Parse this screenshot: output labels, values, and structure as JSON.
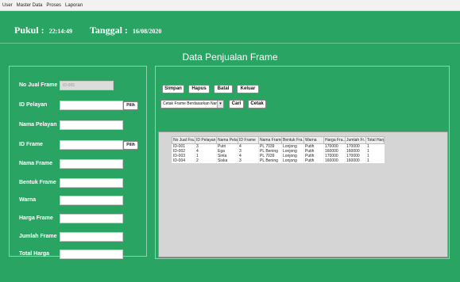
{
  "menu": [
    "User",
    "Master Data",
    "Proses",
    "Laporan"
  ],
  "header": {
    "pukul_label": "Pukul :",
    "pukul_value": "22:14:49",
    "tanggal_label": "Tanggal :",
    "tanggal_value": "16/08/2020"
  },
  "title": "Data Penjualan Frame",
  "form": {
    "no_jual_label": "No Jual Frame",
    "no_jual_value": "ID-005",
    "id_pelayan_label": "ID Pelayan",
    "nama_pelayan_label": "Nama Pelayan",
    "id_frame_label": "ID Frame",
    "nama_frame_label": "Nama Frame",
    "bentuk_frame_label": "Bentuk Frame",
    "warna_label": "Warna",
    "harga_frame_label": "Harga Frame",
    "jumlah_frame_label": "Jumlah Frame",
    "total_harga_label": "Total Harga",
    "pilih_label": "Pilih"
  },
  "actions": {
    "simpan": "Simpan",
    "hapus": "Hapus",
    "batal": "Batal",
    "keluar": "Keluar",
    "cetak_combo": "Cetak Frame Berdasarkan Nam",
    "cari": "Cari",
    "cetak": "Cetak"
  },
  "table": {
    "columns": [
      "No Jual Fra...",
      "ID Pelayan",
      "Nama Pela...",
      "ID Frame",
      "Nama Frame",
      "Bentuk Fra...",
      "Warna",
      "Harga Fra...",
      "Jumlah Fr...",
      "Total Harga"
    ],
    "rows": [
      [
        "ID-001",
        "3",
        "Putri",
        "4",
        "PL 7039",
        "Lonjong",
        "Putih",
        "170000",
        "170000",
        "1"
      ],
      [
        "ID-002",
        "4",
        "Ega",
        "3",
        "PL Bening",
        "Lonjong",
        "Putih",
        "160000",
        "160000",
        "1"
      ],
      [
        "ID-003",
        "1",
        "Sinta",
        "4",
        "PL 7039",
        "Lonjong",
        "Putih",
        "170000",
        "170000",
        "1"
      ],
      [
        "ID-004",
        "2",
        "Siska",
        "3",
        "PL Bening",
        "Lonjong",
        "Putih",
        "160000",
        "160000",
        "1"
      ]
    ]
  }
}
